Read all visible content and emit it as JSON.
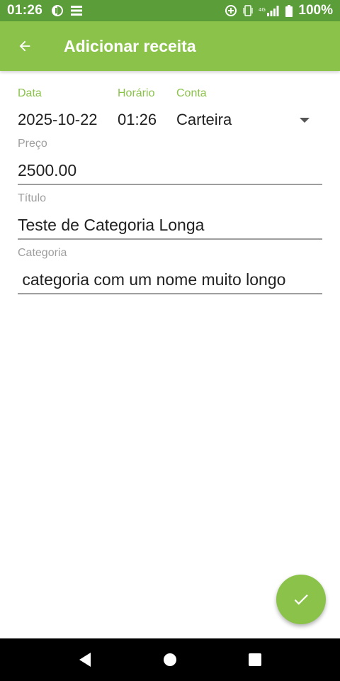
{
  "status_bar": {
    "time": "01:26",
    "battery": "100%",
    "network": "4G"
  },
  "app_bar": {
    "title": "Adicionar receita"
  },
  "form": {
    "data_label": "Data",
    "data_value": "2025-10-22",
    "horario_label": "Horário",
    "horario_value": "01:26",
    "conta_label": "Conta",
    "conta_value": "Carteira",
    "preco_label": "Preço",
    "preco_value": "2500.00",
    "titulo_label": "Título",
    "titulo_value": "Teste de Categoria Longa",
    "categoria_label": "Categoria",
    "categoria_value": " categoria com um nome muito longo"
  },
  "colors": {
    "status_bar": "#5a9d39",
    "primary": "#8bc34a",
    "label_gray": "#9e9e9e"
  }
}
